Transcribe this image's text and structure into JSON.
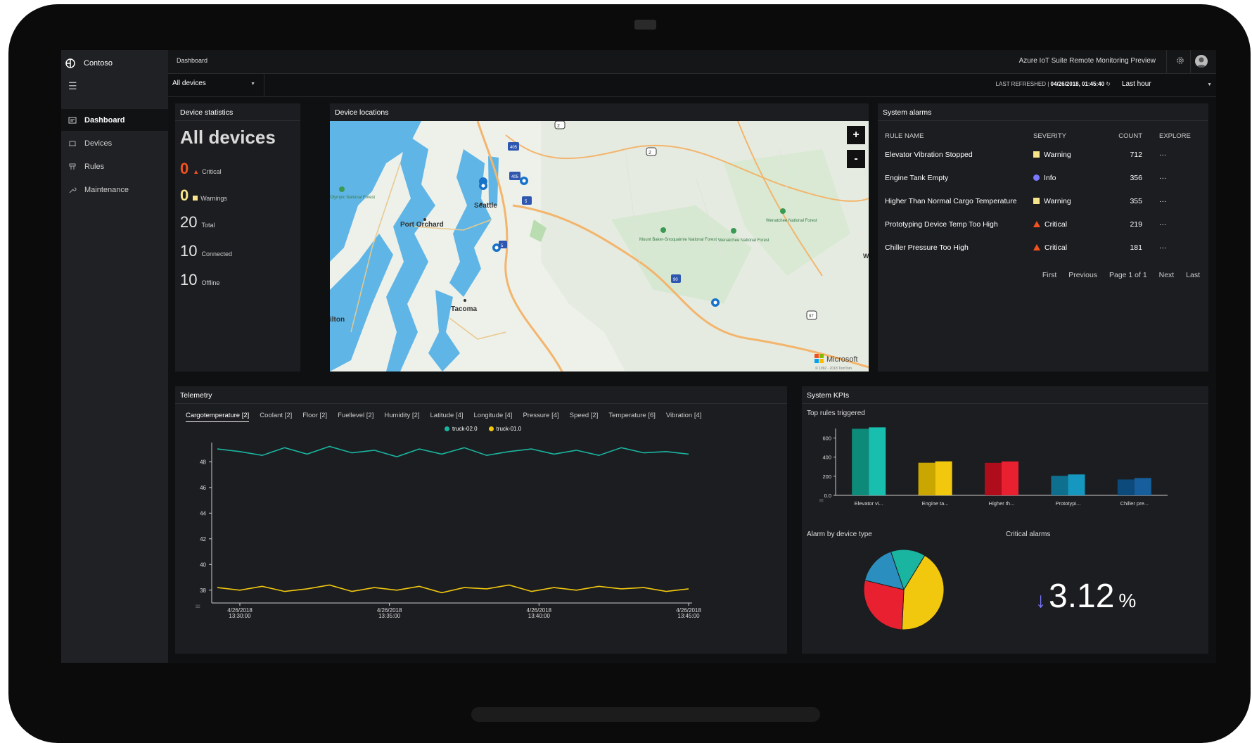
{
  "app": {
    "brand": "Contoso",
    "breadcrumb": "Dashboard",
    "title": "Azure IoT Suite Remote Monitoring Preview"
  },
  "sidebar": {
    "items": [
      {
        "label": "Dashboard",
        "icon": "dashboard-icon",
        "active": true
      },
      {
        "label": "Devices",
        "icon": "devices-icon",
        "active": false
      },
      {
        "label": "Rules",
        "icon": "rules-icon",
        "active": false
      },
      {
        "label": "Maintenance",
        "icon": "maintenance-icon",
        "active": false
      }
    ]
  },
  "filters": {
    "device_group": "All devices",
    "last_refreshed_label": "LAST REFRESHED |",
    "last_refreshed_value": "04/26/2018, 01:45:40",
    "time_range": "Last hour"
  },
  "device_statistics": {
    "title": "Device statistics",
    "heading": "All devices",
    "critical": {
      "value": "0",
      "label": "Critical"
    },
    "warnings": {
      "value": "0",
      "label": "Warnings"
    },
    "total": {
      "value": "20",
      "label": "Total"
    },
    "connected": {
      "value": "10",
      "label": "Connected"
    },
    "offline": {
      "value": "10",
      "label": "Offline"
    }
  },
  "device_locations": {
    "title": "Device locations",
    "zoom_in": "+",
    "zoom_out": "-",
    "attribution": "Microsoft",
    "copyright": "© 1992 - 2018 TomTom",
    "places": [
      "Seattle",
      "Port Orchard",
      "Tacoma",
      "Olympic National Forest",
      "Mount Baker-Snoqualmie National Forest",
      "Wenatchee National Forest",
      "Wenatchee National Forest",
      "ilton",
      "W"
    ],
    "highways": [
      "2",
      "2",
      "405",
      "405",
      "5",
      "5",
      "90",
      "97"
    ]
  },
  "system_alarms": {
    "title": "System alarms",
    "columns": [
      "RULE NAME",
      "SEVERITY",
      "COUNT",
      "EXPLORE"
    ],
    "rows": [
      {
        "rule": "Elevator Vibration Stopped",
        "severity": "Warning",
        "count": "712",
        "explore": "···"
      },
      {
        "rule": "Engine Tank Empty",
        "severity": "Info",
        "count": "356",
        "explore": "···"
      },
      {
        "rule": "Higher Than Normal Cargo Temperature",
        "severity": "Warning",
        "count": "355",
        "explore": "···"
      },
      {
        "rule": "Prototyping Device Temp Too High",
        "severity": "Critical",
        "count": "219",
        "explore": "···"
      },
      {
        "rule": "Chiller Pressure Too High",
        "severity": "Critical",
        "count": "181",
        "explore": "···"
      }
    ],
    "pager": {
      "first": "First",
      "previous": "Previous",
      "page": "Page 1 of 1",
      "next": "Next",
      "last": "Last"
    }
  },
  "telemetry": {
    "title": "Telemetry",
    "tabs": [
      "Cargotemperature [2]",
      "Coolant [2]",
      "Floor [2]",
      "Fuellevel [2]",
      "Humidity [2]",
      "Latitude [4]",
      "Longitude [4]",
      "Pressure [4]",
      "Speed [2]",
      "Temperature [6]",
      "Vibration [4]"
    ],
    "active_tab": 0,
    "legend": [
      {
        "name": "truck-02.0",
        "color": "#1ab5a0"
      },
      {
        "name": "truck-01.0",
        "color": "#f2c80f"
      }
    ]
  },
  "system_kpis": {
    "title": "System KPIs",
    "top_rules_label": "Top rules triggered",
    "alarm_by_type_label": "Alarm by device type",
    "critical_alarms_label": "Critical alarms",
    "critical_alarms_value": "3.12",
    "critical_alarms_unit": "%"
  },
  "chart_data": [
    {
      "type": "line",
      "title": "",
      "x": [
        "4/26/2018 13:30:00",
        "4/26/2018 13:35:00",
        "4/26/2018 13:40:00",
        "4/26/2018 13:45:00"
      ],
      "ylim": [
        37,
        49.5
      ],
      "yticks": [
        38,
        40,
        42,
        44,
        46,
        48
      ],
      "series": [
        {
          "name": "truck-02.0",
          "color": "#1ab5a0",
          "values": [
            49.0,
            48.8,
            48.5,
            49.1,
            48.6,
            49.2,
            48.7,
            48.9,
            48.4,
            49.0,
            48.6,
            49.1,
            48.5,
            48.8,
            49.0,
            48.6,
            48.9,
            48.5,
            49.1,
            48.7,
            48.8,
            48.6
          ]
        },
        {
          "name": "truck-01.0",
          "color": "#f2c80f",
          "values": [
            38.2,
            38.0,
            38.3,
            37.9,
            38.1,
            38.4,
            37.9,
            38.2,
            38.0,
            38.3,
            37.8,
            38.2,
            38.1,
            38.4,
            37.9,
            38.2,
            38.0,
            38.3,
            38.1,
            38.2,
            37.9,
            38.1
          ]
        }
      ]
    },
    {
      "type": "bar",
      "title": "Top rules triggered",
      "categories": [
        "Elevator vi...",
        "Engine ta...",
        "Higher th...",
        "Prototypi...",
        "Chiller pre..."
      ],
      "ylim": [
        0,
        700
      ],
      "yticks": [
        "0.0",
        "200",
        "400",
        "600"
      ],
      "values": [
        712,
        356,
        355,
        219,
        181
      ],
      "colors": [
        [
          "#0d8a7a",
          "#19bfae"
        ],
        [
          "#c9a700",
          "#f2c80f"
        ],
        [
          "#b00d1c",
          "#e8202f"
        ],
        [
          "#0f6f8f",
          "#1697bf"
        ],
        [
          "#0b4a7a",
          "#165f9c"
        ]
      ]
    },
    {
      "type": "pie",
      "title": "Alarm by device type",
      "values": [
        42,
        28,
        16,
        14
      ],
      "colors": [
        "#f2c80f",
        "#e8202f",
        "#2a8fbf",
        "#1ab5a0"
      ]
    }
  ]
}
